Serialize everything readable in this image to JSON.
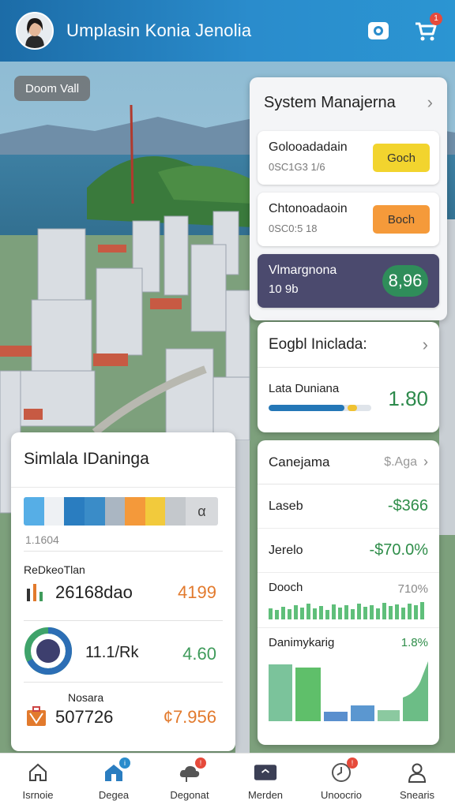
{
  "header": {
    "title": "Umplasin Konia Jenolia",
    "cart_badge": "1"
  },
  "location_chip": "Doom Vall",
  "system_panel": {
    "title": "System Manajerna",
    "items": [
      {
        "title": "Golooadadain",
        "sub": "0SC1G3 1/6",
        "badge": "Goch"
      },
      {
        "title": "Chtonoadaoin",
        "sub": "0SC0:5 18",
        "badge": "Boch"
      },
      {
        "title": "Vlmargnona",
        "sub": "10 9b",
        "badge": "8,96"
      }
    ]
  },
  "global_card": {
    "title": "Eogbl Iniclada:",
    "label": "Lata Duniana",
    "value": "1.80",
    "progress_primary": 0.74,
    "progress_secondary": 0.09
  },
  "finance_card": {
    "title": "Canejama",
    "subtitle": "$.Aga",
    "rows": [
      {
        "label": "Laseb",
        "amount": "-$366"
      },
      {
        "label": "Jerelo",
        "amount": "-$70.0%"
      }
    ],
    "spark": {
      "label": "Dooch",
      "pct": "710%"
    },
    "area": {
      "label": "Danimykarig",
      "pct": "1.8%"
    }
  },
  "sim_card": {
    "title": "Simlala IDaninga",
    "palette_caption": "1.1604",
    "palette_end": "α",
    "palette_colors": [
      "#56aee6",
      "#eef1f4",
      "#2a7dc0",
      "#3a8cc8",
      "#aab6c2",
      "#f4993a",
      "#f2ca3c",
      "#c4c8cc"
    ],
    "rows": [
      {
        "title": "ReDkeoTlan",
        "main": "26168dao",
        "value": "4199"
      },
      {
        "title": "",
        "main": "11.1/Rk",
        "value": "4.60"
      },
      {
        "title": "Nosara",
        "main": "507726",
        "value": "¢7.956"
      }
    ]
  },
  "bottom_nav": [
    {
      "label": "Isrnoie",
      "icon": "home-icon"
    },
    {
      "label": "Degea",
      "icon": "house-badge-icon",
      "badge": "i"
    },
    {
      "label": "Degonat",
      "icon": "cloud-badge-icon",
      "badge": "!"
    },
    {
      "label": "Merden",
      "icon": "message-icon"
    },
    {
      "label": "Unoocrio",
      "icon": "clock-badge-icon",
      "badge": "!"
    },
    {
      "label": "Snearis",
      "icon": "profile-icon"
    }
  ],
  "colors": {
    "header_blue": "#2a8ccc",
    "accent_green": "#2e8d49",
    "accent_orange": "#e27a2d",
    "dark_item": "#4b4a6e"
  }
}
